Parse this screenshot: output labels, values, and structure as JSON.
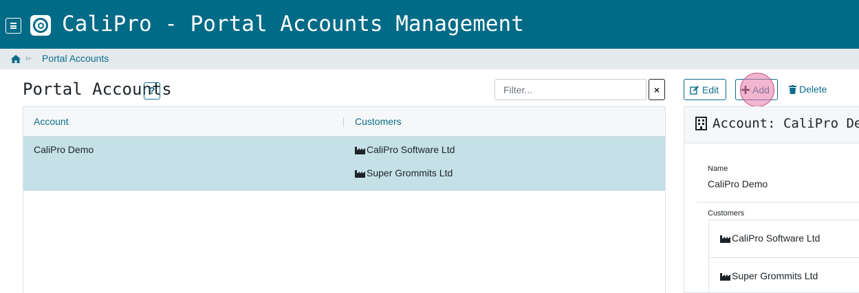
{
  "header": {
    "title": "CaliPro - Portal Accounts Management",
    "bg_color": "#006b87",
    "menu_icon": "hamburger-menu-icon",
    "logo_icon": "calipro-logo-icon"
  },
  "breadcrumb": {
    "home_icon": "home-icon",
    "separator_icon": "triangle-right-icon",
    "items": [
      "Portal Accounts"
    ]
  },
  "page": {
    "title": "Portal Accounts",
    "help_label": "?"
  },
  "filter": {
    "placeholder": "Filter...",
    "value": "",
    "clear_label": "×"
  },
  "table": {
    "columns": [
      "Account",
      "Customers"
    ],
    "rows": [
      {
        "account": "CaliPro Demo",
        "customers": [
          "CaliPro Software Ltd",
          "Super Grommits Ltd"
        ],
        "selected": true
      }
    ],
    "selected_color": "#c5e0e6"
  },
  "toolbar": {
    "edit_label": "Edit",
    "add_label": "Add",
    "delete_label": "Delete",
    "accent_color": "#0b6d8a"
  },
  "detail": {
    "title": "Account: CaliPro Demo",
    "name_label": "Name",
    "name_value": "CaliPro Demo",
    "customers_label": "Customers",
    "customers": [
      "CaliPro Software Ltd",
      "Super Grommits Ltd"
    ]
  }
}
